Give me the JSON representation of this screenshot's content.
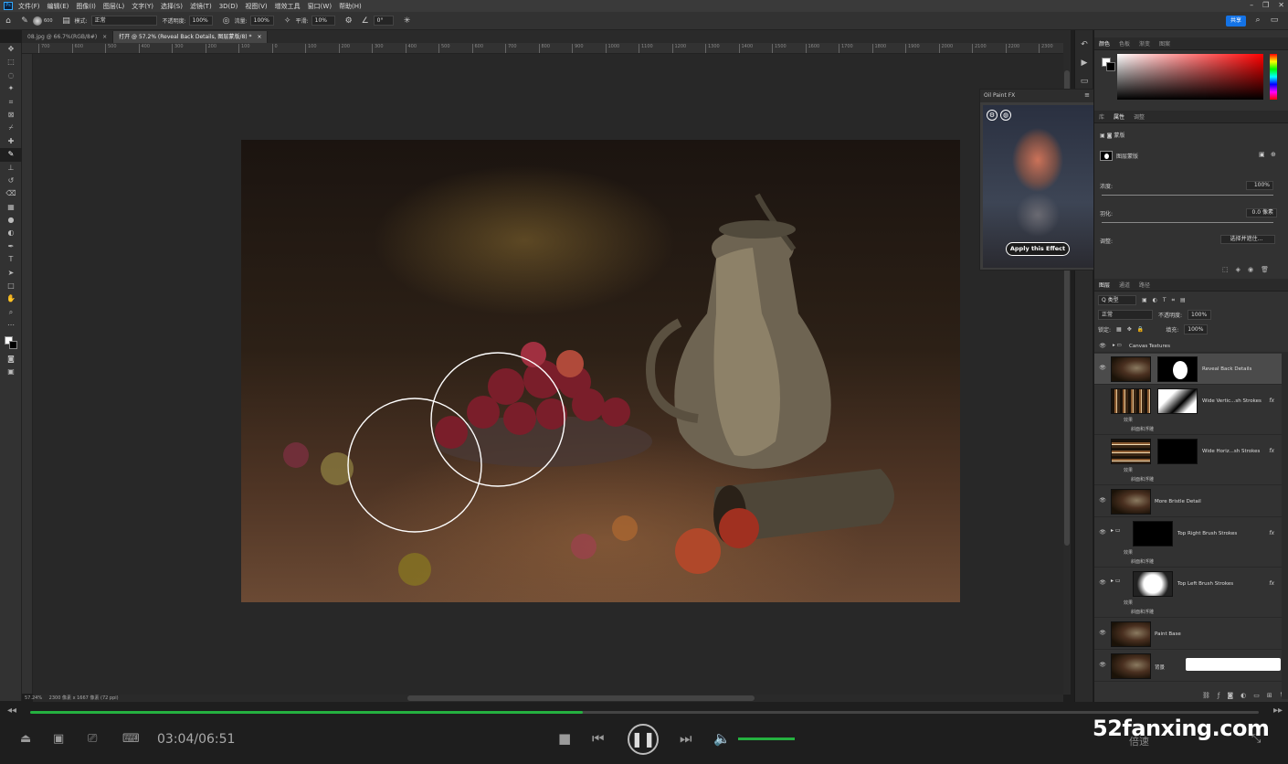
{
  "menubar": {
    "app_logo": "Ps",
    "items": [
      "文件(F)",
      "编辑(E)",
      "图像(I)",
      "图层(L)",
      "文字(Y)",
      "选择(S)",
      "滤镜(T)",
      "3D(D)",
      "视图(V)",
      "增效工具",
      "窗口(W)",
      "帮助(H)"
    ]
  },
  "options": {
    "mode_label": "模式:",
    "mode_value": "正常",
    "opacity_label": "不透明度:",
    "opacity_value": "100%",
    "flow_label": "流量:",
    "flow_value": "100%",
    "smooth_label": "平滑:",
    "smooth_value": "10%",
    "angle_value": "0°",
    "brush_size": "600",
    "share_label": "共享"
  },
  "tabs": [
    {
      "label": "08.jpg @ 66.7%(RGB/8#)"
    },
    {
      "label": "打开 @ 57.2% (Reveal Back Details, 图层蒙版/8) *"
    }
  ],
  "ruler_ticks": [
    "700",
    "600",
    "500",
    "400",
    "300",
    "200",
    "100",
    "0",
    "100",
    "200",
    "300",
    "400",
    "500",
    "600",
    "700",
    "800",
    "900",
    "1000",
    "1100",
    "1200",
    "1300",
    "1400",
    "1500",
    "1600",
    "1700",
    "1800",
    "1900",
    "2000",
    "2100",
    "2200",
    "2300",
    "2400"
  ],
  "statusbar": {
    "zoom": "57.24%",
    "doc_info": "2300 像素 x 1667 像素 (72 ppi)"
  },
  "color_panel": {
    "tabs": [
      "颜色",
      "色板",
      "渐变",
      "图案"
    ]
  },
  "properties": {
    "tabs": [
      "库",
      "属性",
      "调整"
    ],
    "mask_label": "蒙版",
    "layer_mask_label": "图层蒙版",
    "density_label": "浓度:",
    "density_value": "100%",
    "feather_label": "羽化:",
    "feather_value": "0.0 像素",
    "refine_label": "调整:",
    "select_mask_button": "选择并遮住..."
  },
  "layers_panel": {
    "tabs": [
      "图层",
      "通道",
      "路径"
    ],
    "filter_label": "Q 类型",
    "blend_mode": "正常",
    "opacity_label": "不透明度:",
    "opacity_value": "100%",
    "lock_label": "锁定:",
    "fill_label": "填充:",
    "fill_value": "100%",
    "layers": [
      {
        "name": "Canvas Textures",
        "kind": "group",
        "visible": true
      },
      {
        "name": "Reveal Back Details",
        "kind": "masked",
        "visible": true,
        "selected": true
      },
      {
        "name": "Wide Vertic...sh Strokes",
        "kind": "masked",
        "visible": false,
        "fx": "fx",
        "effects_label": "效果",
        "effect": "斜面和浮雕"
      },
      {
        "name": "Wide Horiz...sh Strokes",
        "kind": "masked",
        "visible": false,
        "fx": "fx",
        "effects_label": "效果",
        "effect": "斜面和浮雕"
      },
      {
        "name": "More Bristle Detail",
        "kind": "pixel",
        "visible": true
      },
      {
        "name": "Top Right Brush Strokes",
        "kind": "group-mask",
        "visible": true,
        "fx": "fx",
        "effects_label": "效果",
        "effect": "斜面和浮雕"
      },
      {
        "name": "Top Left Brush Strokes",
        "kind": "group-mask",
        "visible": true,
        "fx": "fx",
        "effects_label": "效果",
        "effect": "斜面和浮雕"
      },
      {
        "name": "Paint Base",
        "kind": "pixel",
        "visible": true
      },
      {
        "name": "背景",
        "kind": "pixel",
        "visible": true
      }
    ]
  },
  "oilpaint": {
    "title": "Oil Paint FX",
    "apply_button": "Apply this Effect"
  },
  "player": {
    "time": "03:04/06:51",
    "progress": 0.45,
    "speed_label": "倍速",
    "watermark": "52fanxing.com"
  },
  "colors": {
    "accent_green": "#25b140",
    "share_blue": "#1473e6"
  }
}
